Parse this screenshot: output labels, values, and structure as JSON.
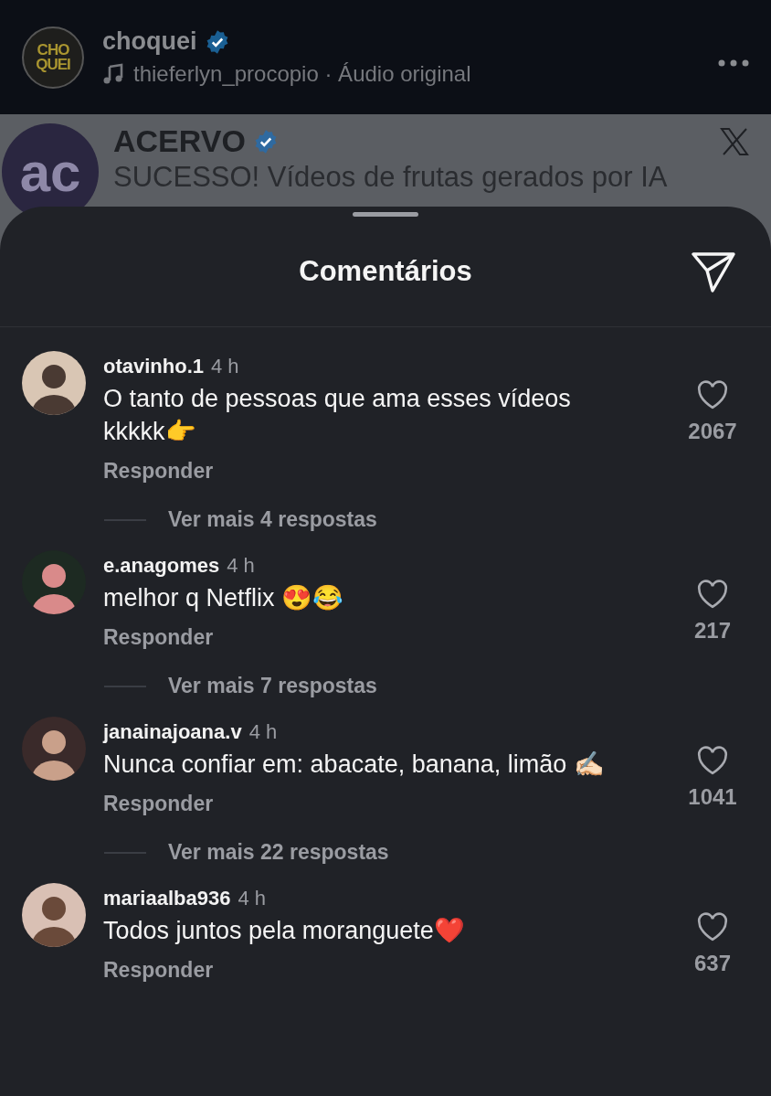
{
  "header": {
    "logo_lines": [
      "CHO",
      "QUEI"
    ],
    "account": "choquei",
    "verified": true,
    "audio": "thieferlyn_procopio · Áudio original"
  },
  "background_post": {
    "logo": "ac",
    "author": "ACERVO",
    "verified": true,
    "text": "SUCESSO! Vídeos de frutas gerados por IA"
  },
  "sheet": {
    "title": "Comentários"
  },
  "comments": [
    {
      "username": "otavinho.1",
      "time": "4 h",
      "text": "O tanto de pessoas que ama esses vídeos kkkkk👉",
      "liked": false,
      "likes": "2067",
      "reply": "Responder",
      "more_replies": "Ver mais 4 respostas"
    },
    {
      "username": "e.anagomes",
      "time": "4 h",
      "text": "melhor q Netflix 😍😂",
      "liked": false,
      "likes": "217",
      "reply": "Responder",
      "more_replies": "Ver mais 7 respostas"
    },
    {
      "username": "janainajoana.v",
      "time": "4 h",
      "text": "Nunca confiar em: abacate, banana, limão ✍🏻",
      "liked": false,
      "likes": "1041",
      "reply": "Responder",
      "more_replies": "Ver mais 22 respostas"
    },
    {
      "username": "mariaalba936",
      "time": "4 h",
      "text": "Todos juntos pela moranguete❤️",
      "liked": false,
      "likes": "637",
      "reply": "Responder"
    }
  ]
}
